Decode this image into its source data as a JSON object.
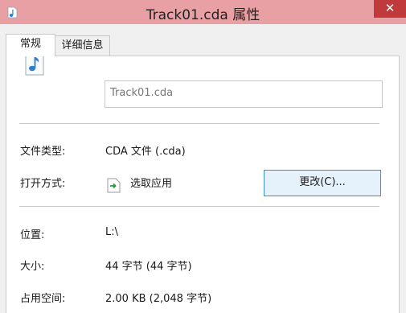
{
  "window": {
    "title": "Track01.cda 属性",
    "close_glyph": "✕",
    "app_icon": "music-file-icon",
    "title_bar_color": "#e8a0a4",
    "close_button_color": "#c0393b"
  },
  "tabs": [
    {
      "label": "常规",
      "selected": true
    },
    {
      "label": "详细信息",
      "selected": false
    }
  ],
  "general": {
    "file_icon": "music-file-icon",
    "file_name": "Track01.cda",
    "file_type_label": "文件类型:",
    "file_type_value": "CDA 文件 (.cda)",
    "opens_with_label": "打开方式:",
    "opens_with_icon": "choose-app-icon",
    "opens_with_value": "选取应用",
    "change_button": "更改(C)...",
    "location_label": "位置:",
    "location_value": "L:\\",
    "size_label": "大小:",
    "size_value": "44 字节 (44 字节)",
    "size_on_disk_label": "占用空间:",
    "size_on_disk_value": "2.00 KB (2,048 字节)"
  },
  "accent_color": "#3c8fd6"
}
